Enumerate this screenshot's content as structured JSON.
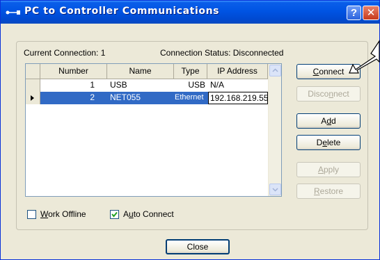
{
  "window": {
    "title": "PC to Controller Communications"
  },
  "connection": {
    "current_label": "Current Connection:",
    "current_value": "1",
    "status_label": "Connection Status:",
    "status_value": "Disconnected"
  },
  "table": {
    "headers": [
      "Number",
      "Name",
      "Type",
      "IP Address"
    ],
    "rows": [
      {
        "number": "1",
        "name": "USB",
        "type": "USB",
        "ip": "N/A"
      },
      {
        "number": "2",
        "name": "NET055",
        "type": "Ethernet",
        "ip": "192.168.219.55"
      }
    ]
  },
  "buttons": {
    "connect": {
      "prefix": "",
      "accel": "C",
      "suffix": "onnect"
    },
    "disconnect": {
      "prefix": "Disco",
      "accel": "n",
      "suffix": "nect"
    },
    "add": {
      "prefix": "A",
      "accel": "d",
      "suffix": "d"
    },
    "delete": {
      "prefix": "D",
      "accel": "e",
      "suffix": "lete"
    },
    "apply": {
      "prefix": "",
      "accel": "A",
      "suffix": "pply"
    },
    "restore": {
      "prefix": "",
      "accel": "R",
      "suffix": "estore"
    },
    "close": "Close"
  },
  "options": {
    "work_offline": {
      "prefix": "",
      "accel": "W",
      "suffix": "ork Offline",
      "checked": false
    },
    "auto_connect": {
      "prefix": "A",
      "accel": "u",
      "suffix": "to Connect",
      "checked": true
    }
  },
  "colors": {
    "titlebar": "#0054e3",
    "selection": "#316ac5",
    "window_bg": "#ece9d8"
  }
}
